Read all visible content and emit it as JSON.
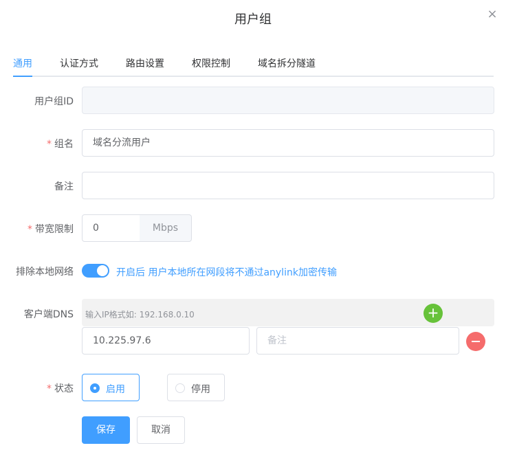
{
  "dialog": {
    "title": "用户组",
    "close_icon": "×"
  },
  "tabs": [
    {
      "label": "通用",
      "active": true
    },
    {
      "label": "认证方式",
      "active": false
    },
    {
      "label": "路由设置",
      "active": false
    },
    {
      "label": "权限控制",
      "active": false
    },
    {
      "label": "域名拆分隧道",
      "active": false
    }
  ],
  "form": {
    "group_id": {
      "label": "用户组ID",
      "value": ""
    },
    "name": {
      "required_mark": "*",
      "label": "组名",
      "value": "域名分流用户"
    },
    "note": {
      "label": "备注",
      "value": ""
    },
    "bandwidth": {
      "required_mark": "*",
      "label": "带宽限制",
      "value": "0",
      "unit": "Mbps"
    },
    "exclude_local": {
      "label": "排除本地网络",
      "enabled": true,
      "text": "开启后 用户本地所在网段将不通过anylink加密传输"
    },
    "client_dns": {
      "label": "客户端DNS",
      "hint": "输入IP格式如: 192.168.0.10",
      "add_icon": "+",
      "entries": [
        {
          "ip": "10.225.97.6",
          "note_placeholder": "备注"
        }
      ]
    },
    "status": {
      "required_mark": "*",
      "label": "状态",
      "options": [
        {
          "label": "启用",
          "checked": true
        },
        {
          "label": "停用",
          "checked": false
        }
      ]
    }
  },
  "actions": {
    "save_label": "保存",
    "cancel_label": "取消"
  },
  "colors": {
    "primary": "#409eff",
    "danger": "#f56c6c",
    "success": "#67c23a"
  }
}
